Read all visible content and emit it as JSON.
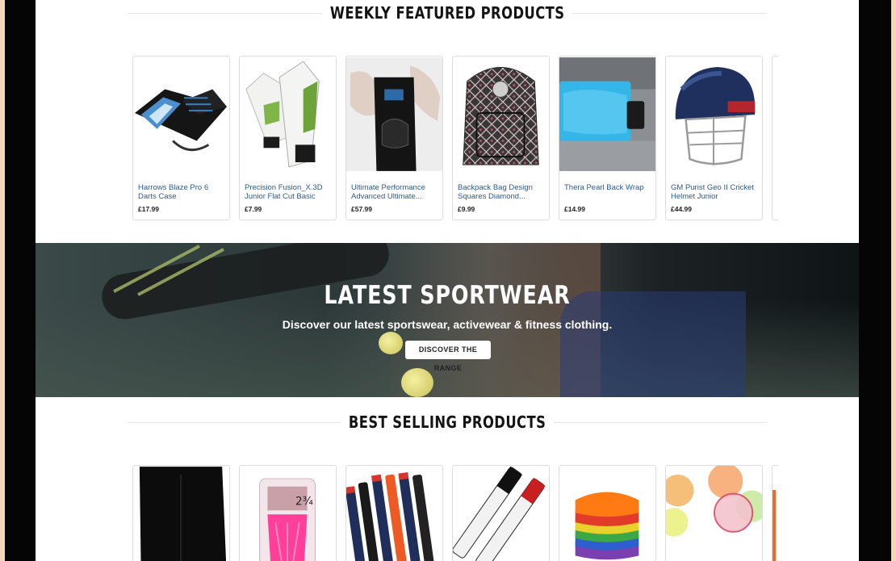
{
  "featured": {
    "title": "WEEKLY FEATURED PRODUCTS",
    "products": [
      {
        "name": "Harrows Blaze Pro 6 Darts Case",
        "price": "£17.99",
        "icon": "darts-case-image"
      },
      {
        "name": "Precision Fusion_X.3D Junior Flat Cut Basic",
        "price": "£7.99",
        "icon": "goalkeeper-gloves-image"
      },
      {
        "name": "Ultimate Performance Advanced Ultimate...",
        "price": "£57.99",
        "icon": "knee-support-image"
      },
      {
        "name": "Backpack Bag Design Squares Diamond...",
        "price": "£9.99",
        "icon": "backpack-image"
      },
      {
        "name": "Thera Pearl Back Wrap",
        "price": "£14.99",
        "icon": "back-wrap-image"
      },
      {
        "name": "GM Purist Geo II Cricket Helmet Junior",
        "price": "£44.99",
        "icon": "cricket-helmet-image"
      }
    ]
  },
  "banner": {
    "headline": "LATEST SPORTWEAR",
    "subtext": "Discover our latest sportswear, activewear & fitness clothing.",
    "button_label": "DISCOVER THE RANGE"
  },
  "best_selling": {
    "title": "BEST SELLING PRODUCTS",
    "products": [
      {
        "icon": "shorts-image"
      },
      {
        "icon": "golf-tees-image"
      },
      {
        "icon": "pens-image"
      },
      {
        "icon": "markers-image"
      },
      {
        "icon": "cones-image"
      },
      {
        "icon": "discs-image"
      }
    ]
  },
  "colors": {
    "product_link": "#2d5b8a",
    "page_bg": "#f3d9b8",
    "frame": "#050505"
  }
}
